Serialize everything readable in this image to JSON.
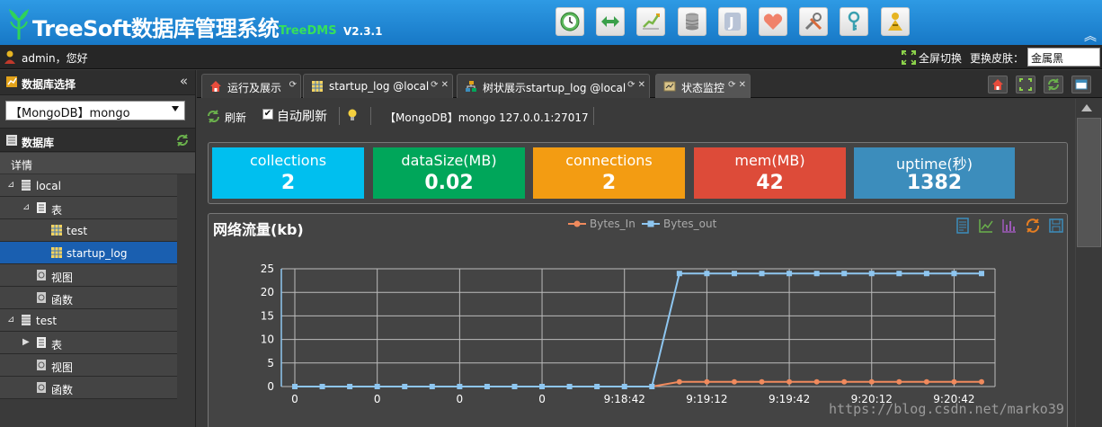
{
  "header": {
    "title": "TreeSoft数据库管理系统",
    "subtitle": "TreeDMS",
    "version": "V2.3.1",
    "icons": [
      "clock-icon",
      "exchange-icon",
      "chart-icon",
      "database-icon",
      "j-icon",
      "heart-icon",
      "tools-icon",
      "key-icon",
      "user-key-icon"
    ]
  },
  "userbar": {
    "greeting": "admin，您好",
    "fullscreen": "全屏切换",
    "skin_label": "更换皮肤：",
    "skin_value": "金属黑"
  },
  "sidebar": {
    "db_select_header": "数据库选择",
    "db_select_value": "【MongoDB】mongo",
    "db_header": "数据库",
    "detail": "详情",
    "tree": [
      {
        "label": "local",
        "level": 0,
        "toggle": "⊿",
        "icon": "db"
      },
      {
        "label": "表",
        "level": 1,
        "toggle": "⊿",
        "icon": "doc"
      },
      {
        "label": "test",
        "level": 2,
        "toggle": "",
        "icon": "table"
      },
      {
        "label": "startup_log",
        "level": 2,
        "toggle": "",
        "icon": "table",
        "selected": true
      },
      {
        "label": "视图",
        "level": 1,
        "toggle": "",
        "icon": "view"
      },
      {
        "label": "函数",
        "level": 1,
        "toggle": "",
        "icon": "view"
      },
      {
        "label": "test",
        "level": 0,
        "toggle": "⊿",
        "icon": "db"
      },
      {
        "label": "表",
        "level": 1,
        "toggle": "▶",
        "icon": "doc"
      },
      {
        "label": "视图",
        "level": 1,
        "toggle": "",
        "icon": "view"
      },
      {
        "label": "函数",
        "level": 1,
        "toggle": "",
        "icon": "view"
      }
    ]
  },
  "tabs": [
    {
      "label": "运行及展示",
      "close": "⟳"
    },
    {
      "label": "startup_log @local",
      "close": "⟳ ✕"
    },
    {
      "label": "树状展示startup_log @local",
      "close": "⟳ ✕"
    },
    {
      "label": "状态监控",
      "close": "⟳ ✕",
      "active": true
    }
  ],
  "toolbar": {
    "refresh": "刷新",
    "auto_refresh": "自动刷新",
    "connection": "【MongoDB】mongo 127.0.0.1:27017"
  },
  "stats": [
    {
      "key": "collections",
      "value": "2",
      "color": "#00bfef"
    },
    {
      "key": "dataSize(MB)",
      "value": "0.02",
      "color": "#00a65a"
    },
    {
      "key": "connections",
      "value": "2",
      "color": "#f39c12"
    },
    {
      "key": "mem(MB)",
      "value": "42",
      "color": "#dd4b39"
    },
    {
      "key": "uptime(秒)",
      "value": "1382",
      "color": "#3c8dbc"
    }
  ],
  "chart_title": "网络流量(kb)",
  "chart_data": {
    "type": "line",
    "categories": [
      "0",
      "0",
      "0",
      "0",
      "0",
      "0",
      "0",
      "0",
      "0",
      "0",
      "0",
      "0",
      "0",
      "9:18:42",
      "9:18:52",
      "9:19:02",
      "9:19:12",
      "9:19:22",
      "9:19:32",
      "9:19:42",
      "9:19:52",
      "9:20:02",
      "9:20:12",
      "9:20:22",
      "9:20:32",
      "9:20:42"
    ],
    "tick_labels": [
      "0",
      "0",
      "0",
      "0",
      "9:18:42",
      "9:19:12",
      "9:19:42",
      "9:20:12",
      "9:20:42"
    ],
    "series": [
      {
        "name": "Bytes_In",
        "color": "#f08a5d",
        "values": [
          0,
          0,
          0,
          0,
          0,
          0,
          0,
          0,
          0,
          0,
          0,
          0,
          0,
          0,
          1,
          1,
          1,
          1,
          1,
          1,
          1,
          1,
          1,
          1,
          1,
          1
        ]
      },
      {
        "name": "Bytes_out",
        "color": "#8ec6f0",
        "values": [
          0,
          0,
          0,
          0,
          0,
          0,
          0,
          0,
          0,
          0,
          0,
          0,
          0,
          0,
          24,
          24,
          24,
          24,
          24,
          24,
          24,
          24,
          24,
          24,
          24,
          24
        ]
      }
    ],
    "yticks": [
      0,
      5,
      10,
      15,
      20,
      25
    ],
    "ylim": [
      0,
      25
    ]
  },
  "watermark": "https://blog.csdn.net/marko39"
}
